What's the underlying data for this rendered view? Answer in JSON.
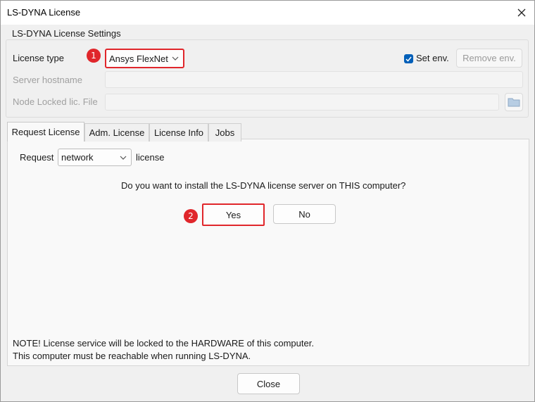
{
  "window": {
    "title": "LS-DYNA License"
  },
  "settings": {
    "group_title": "LS-DYNA License Settings",
    "license_type_label": "License type",
    "license_type_value": "Ansys FlexNet",
    "set_env_label": "Set env.",
    "set_env_checked": true,
    "remove_env_label": "Remove env.",
    "server_hostname_label": "Server hostname",
    "server_hostname_value": "",
    "node_locked_label": "Node Locked lic. File",
    "node_locked_value": ""
  },
  "tabs": [
    {
      "label": "Request License",
      "active": true
    },
    {
      "label": "Adm. License",
      "active": false
    },
    {
      "label": "License Info",
      "active": false
    },
    {
      "label": "Jobs",
      "active": false
    }
  ],
  "request": {
    "prefix_label": "Request",
    "type_value": "network",
    "suffix_label": "license",
    "question": "Do you want to install the LS-DYNA license server on THIS computer?",
    "yes_label": "Yes",
    "no_label": "No",
    "note_line1": "NOTE! License service will be locked to the HARDWARE of this computer.",
    "note_line2": "This computer must be reachable when running LS-DYNA."
  },
  "footer": {
    "close_label": "Close"
  },
  "annotations": {
    "badge1": "1",
    "badge2": "2"
  },
  "colors": {
    "highlight": "#e0262b",
    "accent": "#005fb8"
  }
}
